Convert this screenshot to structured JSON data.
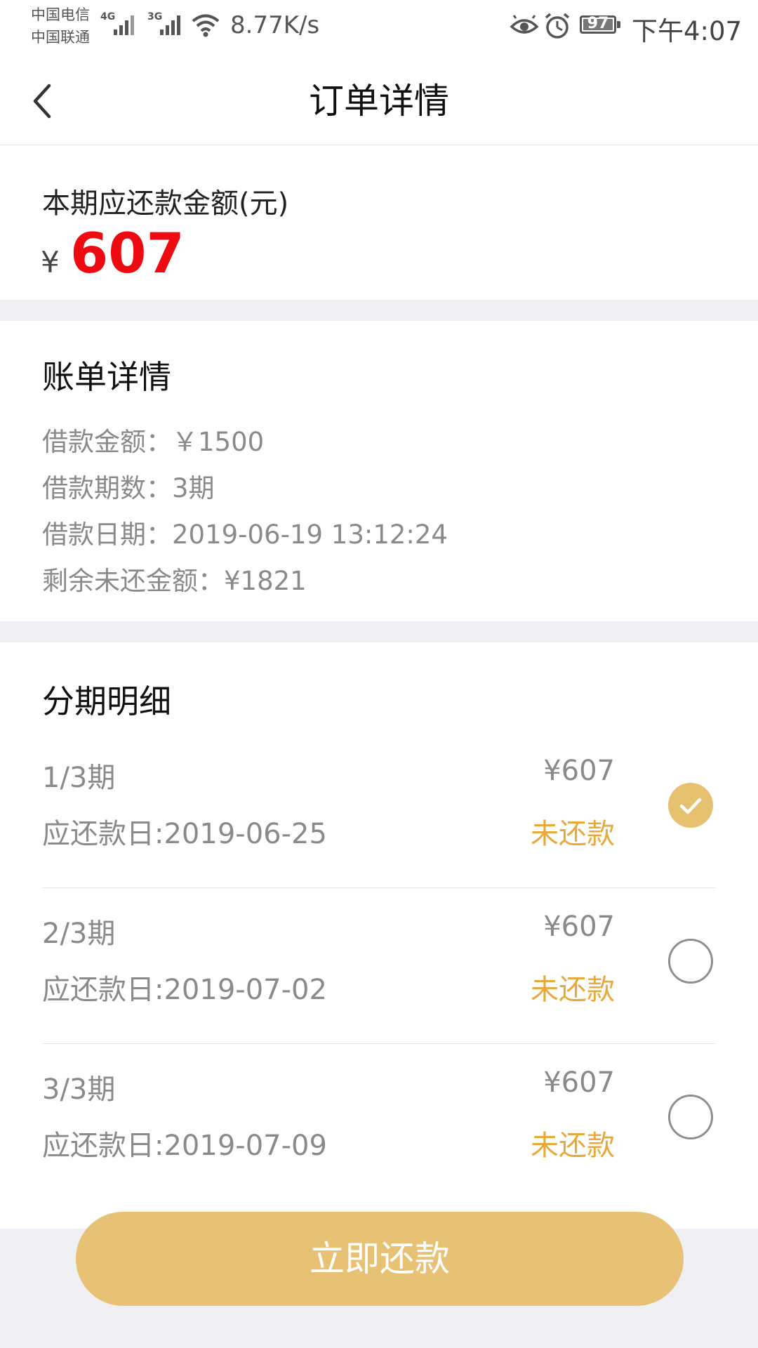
{
  "status_bar": {
    "carrier1": "中国电信",
    "carrier2": "中国联通",
    "network1": "4G",
    "network2": "3G",
    "net_speed": "8.77K/s",
    "battery_level": "97",
    "time": "下午4:07",
    "icons": [
      "signal-icon",
      "signal-icon",
      "wifi-icon",
      "eye-icon",
      "alarm-icon",
      "battery-icon"
    ]
  },
  "nav": {
    "title": "订单详情",
    "back_icon": "chevron-left-icon"
  },
  "amount": {
    "label": "本期应还款金额(元)",
    "currency": "¥",
    "value": "607",
    "value_color": "#ee0a11"
  },
  "bill": {
    "title": "账单详情",
    "lines": [
      "借款金额：￥1500",
      "借款期数：3期",
      "借款日期：2019-06-19 13:12:24",
      "剩余未还金额：¥1821"
    ]
  },
  "installments": {
    "title": "分期明细",
    "items": [
      {
        "period": "1/3期",
        "amount": "¥607",
        "due": "应还款日:2019-06-25",
        "status": "未还款",
        "selected": true
      },
      {
        "period": "2/3期",
        "amount": "¥607",
        "due": "应还款日:2019-07-02",
        "status": "未还款",
        "selected": false
      },
      {
        "period": "3/3期",
        "amount": "¥607",
        "due": "应还款日:2019-07-09",
        "status": "未还款",
        "selected": false
      }
    ]
  },
  "pay_button": {
    "label": "立即还款",
    "color": "#e8c274"
  },
  "colors": {
    "accent_gold": "#e6c16f",
    "status_orange": "#e8a83b",
    "background": "#efeff4"
  }
}
